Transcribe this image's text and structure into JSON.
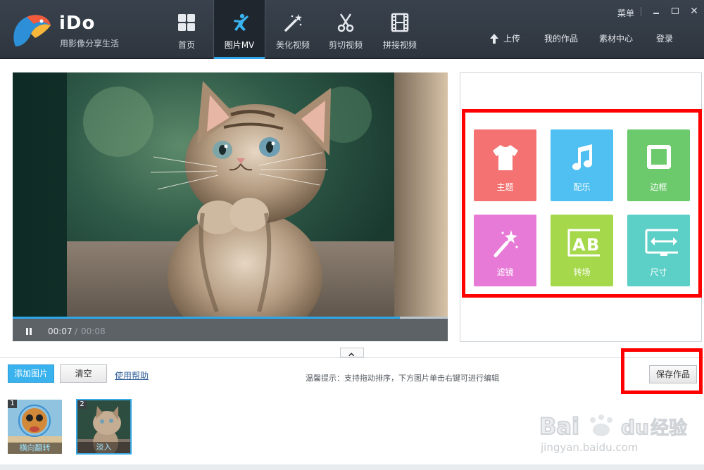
{
  "app": {
    "name": "iDo",
    "slogan": "用影像分享生活"
  },
  "nav": {
    "tabs": [
      {
        "label": "首页",
        "icon": "grid-icon"
      },
      {
        "label": "图片MV",
        "icon": "dancer-icon",
        "active": true
      },
      {
        "label": "美化视频",
        "icon": "magic-wand-icon"
      },
      {
        "label": "剪切视频",
        "icon": "scissors-icon"
      },
      {
        "label": "拼接视频",
        "icon": "film-strip-icon"
      }
    ]
  },
  "header_links": {
    "menu": "菜单",
    "upload": "上传",
    "my_works": "我的作品",
    "materials": "素材中心",
    "login": "登录"
  },
  "player": {
    "current_time": "00:07",
    "separator": "/",
    "total_time": "00:08",
    "progress": 0.89
  },
  "tools": [
    {
      "label": "主题",
      "icon": "tshirt-icon",
      "color": "#f47272"
    },
    {
      "label": "配乐",
      "icon": "music-note-icon",
      "color": "#4fc0f1"
    },
    {
      "label": "边框",
      "icon": "frame-icon",
      "color": "#6cca6d"
    },
    {
      "label": "滤镜",
      "icon": "magic-wand-icon",
      "color": "#e779d7"
    },
    {
      "label": "转场",
      "icon": "ab-icon",
      "color": "#a5d84a"
    },
    {
      "label": "尺寸",
      "icon": "monitor-resize-icon",
      "color": "#5ccfc7"
    }
  ],
  "bottom_bar": {
    "add_photo": "添加图片",
    "clear": "清空",
    "help": "使用帮助",
    "tip": "温馨提示：支持拖动排序，下方图片单击右键可进行编辑",
    "save": "保存作品"
  },
  "thumbnails": [
    {
      "index": "1",
      "caption": "横向翻转"
    },
    {
      "index": "2",
      "caption": "淡入",
      "selected": true
    }
  ],
  "watermark": {
    "text": "Bai du 经验",
    "url": "jingyan.baidu.com"
  },
  "colors": {
    "accent": "#2fa6e8",
    "highlight_box": "#ff0000",
    "topbar": "#343c46"
  }
}
